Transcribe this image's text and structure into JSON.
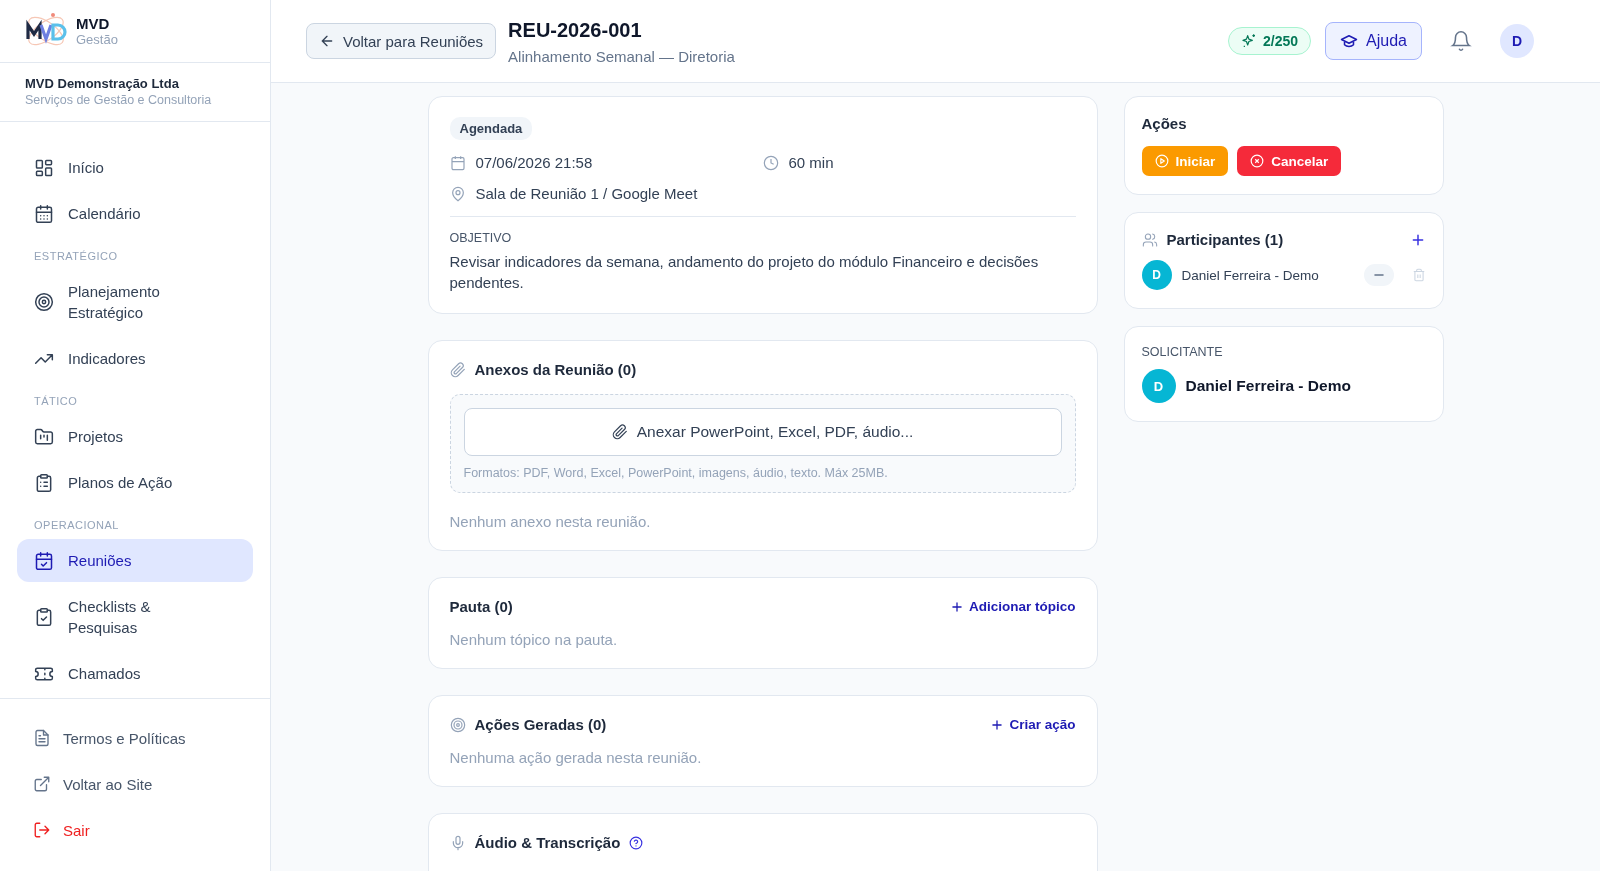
{
  "brand": {
    "name": "MVD",
    "subtitle": "Gestão"
  },
  "company": {
    "name": "MVD Demonstração Ltda",
    "description": "Serviços de Gestão e Consultoria"
  },
  "nav": [
    {
      "items": [
        {
          "label": "Início",
          "kind": "grid",
          "selected": false
        },
        {
          "label": "Calendário",
          "kind": "calendar",
          "selected": false
        }
      ]
    },
    {
      "heading": "ESTRATÉGICO",
      "items": [
        {
          "label": "Planejamento Estratégico",
          "kind": "target",
          "selected": false
        },
        {
          "label": "Indicadores",
          "kind": "trend",
          "selected": false
        }
      ]
    },
    {
      "heading": "TÁTICO",
      "items": [
        {
          "label": "Projetos",
          "kind": "folder",
          "selected": false
        },
        {
          "label": "Planos de Ação",
          "kind": "clipboard",
          "selected": false
        }
      ]
    },
    {
      "heading": "OPERACIONAL",
      "items": [
        {
          "label": "Reuniões",
          "kind": "calendar-check",
          "selected": true
        },
        {
          "label": "Checklists & Pesquisas",
          "kind": "clipboard-check",
          "selected": false
        },
        {
          "label": "Chamados",
          "kind": "ticket",
          "selected": false
        }
      ]
    }
  ],
  "footer_links": [
    {
      "label": "Termos e Políticas",
      "kind": "document"
    },
    {
      "label": "Voltar ao Site",
      "kind": "external"
    },
    {
      "label": "Sair",
      "kind": "logout"
    }
  ],
  "header": {
    "back_button": "Voltar para Reuniões",
    "title": "REU-2026-001",
    "subtitle": "Alinhamento Semanal — Diretoria",
    "credits": "2/250",
    "help": "Ajuda",
    "avatar": "D"
  },
  "meeting": {
    "status": "Agendada",
    "date": "07/06/2026 21:58",
    "duration": "60 min",
    "location": "Sala de Reunião 1 / Google Meet",
    "objective_label": "OBJETIVO",
    "objective": "Revisar indicadores da semana, andamento do projeto do módulo Financeiro e decisões pendentes."
  },
  "attachments": {
    "title": "Anexos da Reunião (0)",
    "upload_button": "Anexar PowerPoint, Excel, PDF, áudio...",
    "formats": "Formatos: PDF, Word, Excel, PowerPoint, imagens, áudio, texto. Máx 25MB.",
    "empty": "Nenhum anexo nesta reunião."
  },
  "agenda": {
    "title": "Pauta (0)",
    "action": "Adicionar tópico",
    "empty": "Nenhum tópico na pauta."
  },
  "generated_actions": {
    "title": "Ações Geradas (0)",
    "action": "Criar ação",
    "empty": "Nenhuma ação gerada nesta reunião."
  },
  "audio": {
    "title": "Áudio & Transcrição"
  },
  "actions_panel": {
    "title": "Ações",
    "buttons": [
      {
        "label": "Iniciar",
        "kind": "start"
      },
      {
        "label": "Cancelar",
        "kind": "cancel"
      }
    ]
  },
  "participants": {
    "title": "Participantes (1)",
    "people": [
      {
        "initial": "D",
        "name": "Daniel Ferreira - Demo"
      }
    ]
  },
  "requester": {
    "label": "SOLICITANTE",
    "initial": "D",
    "name": "Daniel Ferreira - Demo"
  }
}
